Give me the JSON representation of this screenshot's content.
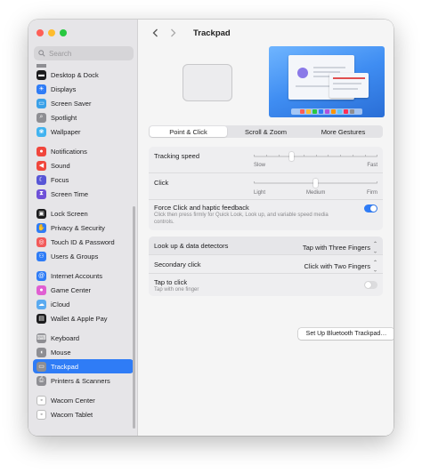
{
  "search": {
    "placeholder": "Search"
  },
  "sidebar": {
    "items": [
      {
        "label": "",
        "color": "#8e8e93"
      },
      {
        "label": "Desktop & Dock",
        "color": "#1c1c1e"
      },
      {
        "label": "Displays",
        "color": "#2f7cf6"
      },
      {
        "label": "Screen Saver",
        "color": "#3aa0e8"
      },
      {
        "label": "Spotlight",
        "color": "#8e8e93"
      },
      {
        "label": "Wallpaper",
        "color": "#41b3f0"
      },
      {
        "label": "Notifications",
        "color": "#f0463c"
      },
      {
        "label": "Sound",
        "color": "#f0463c"
      },
      {
        "label": "Focus",
        "color": "#5856d6"
      },
      {
        "label": "Screen Time",
        "color": "#6e50d8"
      },
      {
        "label": "Lock Screen",
        "color": "#1c1c1e"
      },
      {
        "label": "Privacy & Security",
        "color": "#2f7cf6"
      },
      {
        "label": "Touch ID & Password",
        "color": "#f25a5a"
      },
      {
        "label": "Users & Groups",
        "color": "#2f7cf6"
      },
      {
        "label": "Internet Accounts",
        "color": "#2f7cf6"
      },
      {
        "label": "Game Center",
        "color": "#e05fd2"
      },
      {
        "label": "iCloud",
        "color": "#5aaaf0"
      },
      {
        "label": "Wallet & Apple Pay",
        "color": "#1c1c1e"
      },
      {
        "label": "Keyboard",
        "color": "#8e8e93"
      },
      {
        "label": "Mouse",
        "color": "#8e8e93"
      },
      {
        "label": "Trackpad",
        "color": "#8e8e93"
      },
      {
        "label": "Printers & Scanners",
        "color": "#8e8e93"
      },
      {
        "label": "Wacom Center",
        "color": "#1c1c1e"
      },
      {
        "label": "Wacom Tablet",
        "color": "#1c1c1e"
      }
    ],
    "selected": "Trackpad"
  },
  "header": {
    "title": "Trackpad"
  },
  "tabs": [
    {
      "label": "Point & Click",
      "selected": true
    },
    {
      "label": "Scroll & Zoom",
      "selected": false
    },
    {
      "label": "More Gestures",
      "selected": false
    }
  ],
  "tracking": {
    "label": "Tracking speed",
    "min_label": "Slow",
    "max_label": "Fast",
    "level": 0.3
  },
  "click": {
    "label": "Click",
    "labels": [
      "Light",
      "Medium",
      "Firm"
    ],
    "level": 0.5
  },
  "force_click": {
    "label": "Force Click and haptic feedback",
    "description": "Click then press firmly for Quick Look, Look up, and variable speed media controls.",
    "enabled": true
  },
  "lookup": {
    "label": "Look up & data detectors",
    "value": "Tap with Three Fingers"
  },
  "secondary": {
    "label": "Secondary click",
    "value": "Click with Two Fingers"
  },
  "tap": {
    "label": "Tap to click",
    "description": "Tap with one finger",
    "enabled": false
  },
  "buttons": {
    "bluetooth": "Set Up Bluetooth Trackpad…",
    "help": "?"
  },
  "colors": {
    "accent": "#2f7cf6"
  }
}
